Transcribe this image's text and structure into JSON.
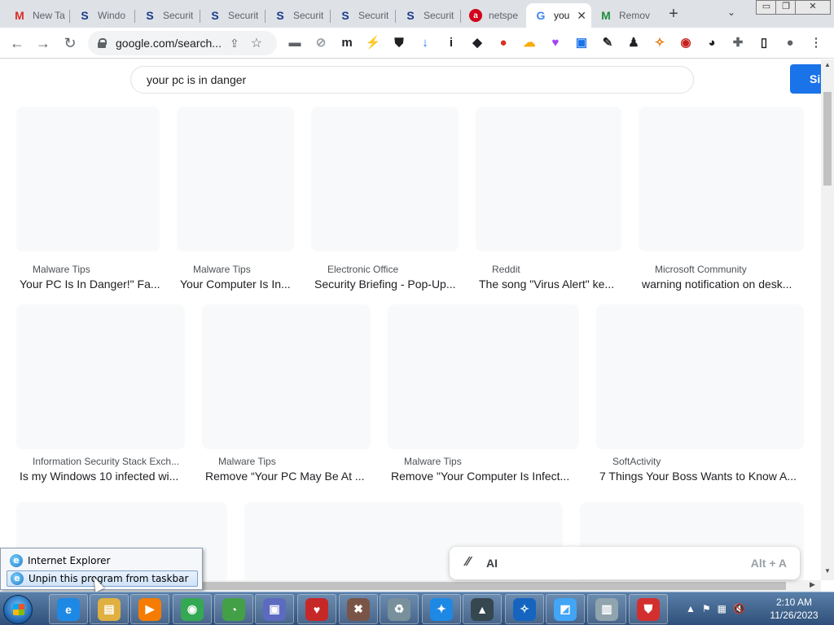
{
  "tabs": [
    {
      "title": "New Ta",
      "favicon": "gmail-icon",
      "color": "#4285f4",
      "glyph": "✉"
    },
    {
      "title": "Windo",
      "favicon": "s-logo-icon",
      "color": "#1a3b8a",
      "glyph": "S"
    },
    {
      "title": "Securit",
      "favicon": "s-logo-icon",
      "color": "#1a3b8a",
      "glyph": "S"
    },
    {
      "title": "Securit",
      "favicon": "s-logo-icon",
      "color": "#1a3b8a",
      "glyph": "S"
    },
    {
      "title": "Securit",
      "favicon": "s-logo-icon",
      "color": "#1a3b8a",
      "glyph": "S"
    },
    {
      "title": "Securit",
      "favicon": "s-logo-icon",
      "color": "#1a3b8a",
      "glyph": "S"
    },
    {
      "title": "Securit",
      "favicon": "s-logo-icon",
      "color": "#1a3b8a",
      "glyph": "S"
    },
    {
      "title": "netspe",
      "favicon": "ask-icon",
      "color": "#d0021b",
      "glyph": "a"
    },
    {
      "title": "you",
      "favicon": "google-icon",
      "color": "#4285f4",
      "glyph": "G",
      "active": true
    },
    {
      "title": "Remov",
      "favicon": "malwaretips-icon",
      "color": "#1e8e3e",
      "glyph": "M"
    }
  ],
  "window": {
    "minimize": "▭",
    "restore": "❐",
    "close": "✕"
  },
  "toolbar": {
    "url": "google.com/search...",
    "extensions": [
      {
        "name": "folder-ext-icon",
        "color": "#5f6368",
        "glyph": "▬"
      },
      {
        "name": "compass-ext-icon",
        "color": "#9aa0a6",
        "glyph": "⊘"
      },
      {
        "name": "m-ext-icon",
        "color": "#202124",
        "glyph": "m"
      },
      {
        "name": "bolt-ext-icon",
        "color": "#9aa0a6",
        "glyph": "⚡"
      },
      {
        "name": "shield-ext-icon",
        "color": "#202124",
        "glyph": "⛊"
      },
      {
        "name": "download-ext-icon",
        "color": "#1a73e8",
        "glyph": "↓"
      },
      {
        "name": "info-ext-icon",
        "color": "#202124",
        "glyph": "i"
      },
      {
        "name": "box-ext-icon",
        "color": "#202124",
        "glyph": "◆"
      },
      {
        "name": "record-ext-icon",
        "color": "#d93025",
        "glyph": "●"
      },
      {
        "name": "cloud-ext-icon",
        "color": "#f9ab00",
        "glyph": "☁"
      },
      {
        "name": "heart-ext-icon",
        "color": "#a142f4",
        "glyph": "♥"
      },
      {
        "name": "screen-ext-icon",
        "color": "#1a73e8",
        "glyph": "▣"
      },
      {
        "name": "edit-ext-icon",
        "color": "#202124",
        "glyph": "✎"
      },
      {
        "name": "person-ext-icon",
        "color": "#202124",
        "glyph": "♟"
      },
      {
        "name": "broom-ext-icon",
        "color": "#e37400",
        "glyph": "✧"
      },
      {
        "name": "color-ext-icon",
        "color": "#c5221f",
        "glyph": "◉"
      },
      {
        "name": "cat-ext-icon",
        "color": "#202124",
        "glyph": "◕"
      },
      {
        "name": "puzzle-icon",
        "color": "#5f6368",
        "glyph": "✚"
      },
      {
        "name": "sidepanel-icon",
        "color": "#202124",
        "glyph": "▯"
      },
      {
        "name": "profile-icon",
        "color": "#5f6368",
        "glyph": "●"
      },
      {
        "name": "menu-icon",
        "color": "#5f6368",
        "glyph": "⋮"
      }
    ]
  },
  "search": {
    "query": "your pc is in danger",
    "signin_label": "Si"
  },
  "results_row1": [
    {
      "source": "Malware Tips",
      "title": "Your PC Is In Danger!\" Fa..."
    },
    {
      "source": "Malware Tips",
      "title": "Your Computer Is In..."
    },
    {
      "source": "Electronic Office",
      "title": "Security Briefing - Pop-Up..."
    },
    {
      "source": "Reddit",
      "title": "The song \"Virus Alert\" ke..."
    },
    {
      "source": "Microsoft Community",
      "title": "warning notification on desk..."
    }
  ],
  "results_row2": [
    {
      "source": "Information Security Stack Exch...",
      "title": "Is my Windows 10 infected wi..."
    },
    {
      "source": "Malware Tips",
      "title": "Remove “Your PC May Be At ..."
    },
    {
      "source": "Malware Tips",
      "title": "Remove \"Your Computer Is Infect..."
    },
    {
      "source": "SoftActivity",
      "title": "7 Things Your Boss Wants to Know A..."
    }
  ],
  "ai_bar": {
    "label": "AI",
    "shortcut": "Alt + A"
  },
  "jumplist": {
    "items": [
      "Internet Explorer",
      "Unpin this program from taskbar"
    ]
  },
  "taskbar": {
    "apps": [
      {
        "name": "internet-explorer-icon",
        "color": "#1e88e5",
        "glyph": "e"
      },
      {
        "name": "file-explorer-icon",
        "color": "#e0b040",
        "glyph": "▤"
      },
      {
        "name": "media-player-icon",
        "color": "#f57c00",
        "glyph": "▶"
      },
      {
        "name": "chrome-icon",
        "color": "#34a853",
        "glyph": "◉"
      },
      {
        "name": "speedometer-icon",
        "color": "#43a047",
        "glyph": "◔"
      },
      {
        "name": "installer-icon",
        "color": "#5c6bc0",
        "glyph": "▣"
      },
      {
        "name": "heartbeat-icon",
        "color": "#c62828",
        "glyph": "♥"
      },
      {
        "name": "tools-icon",
        "color": "#795548",
        "glyph": "✖"
      },
      {
        "name": "recycle-icon",
        "color": "#78909c",
        "glyph": "♻"
      },
      {
        "name": "cleaner-icon",
        "color": "#1e88e5",
        "glyph": "✦"
      },
      {
        "name": "eagle-icon",
        "color": "#37474f",
        "glyph": "▲"
      },
      {
        "name": "broom-icon",
        "color": "#1565c0",
        "glyph": "✧"
      },
      {
        "name": "monitor-icon",
        "color": "#42a5f5",
        "glyph": "◩"
      },
      {
        "name": "trash-icon",
        "color": "#90a4ae",
        "glyph": "▥"
      },
      {
        "name": "antivirus-shield-icon",
        "color": "#d32f2f",
        "glyph": "⛊"
      }
    ],
    "time": "2:10 AM",
    "date": "11/26/2023"
  }
}
